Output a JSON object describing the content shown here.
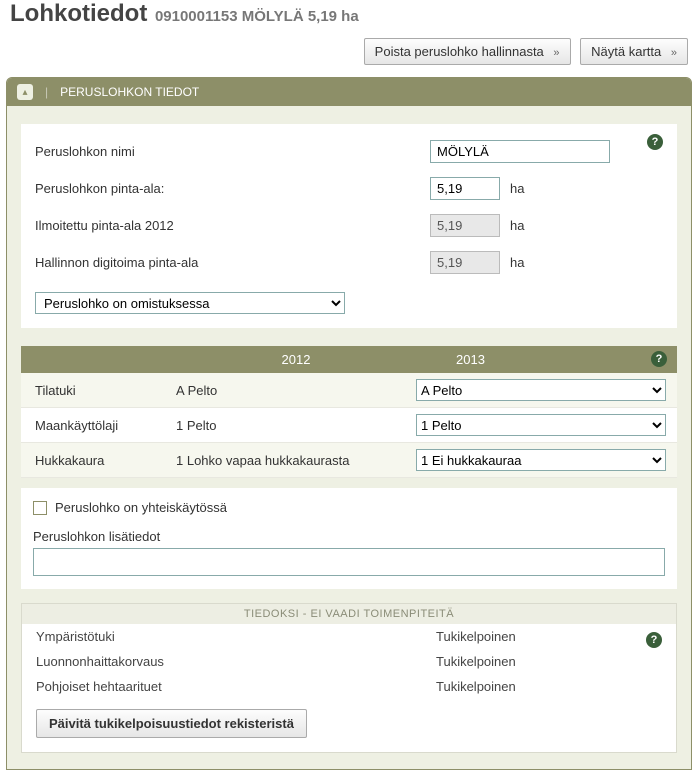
{
  "header": {
    "title": "Lohkotiedot",
    "subtitle": "0910001153 MÖLYLÄ 5,19 ha"
  },
  "topButtons": {
    "remove": "Poista peruslohko hallinnasta",
    "showMap": "Näytä kartta"
  },
  "panel": {
    "title": "PERUSLOHKON TIEDOT"
  },
  "form": {
    "nameLabel": "Peruslohkon nimi",
    "nameValue": "MÖLYLÄ",
    "areaLabel": "Peruslohkon pinta-ala:",
    "areaValue": "5,19",
    "areaUnit": "ha",
    "reportedLabel": "Ilmoitettu pinta-ala 2012",
    "reportedValue": "5,19",
    "reportedUnit": "ha",
    "digitLabel": "Hallinnon digitoima pinta-ala",
    "digitValue": "5,19",
    "digitUnit": "ha",
    "ownershipSelect": "Peruslohko on omistuksessa"
  },
  "table": {
    "head2012": "2012",
    "head2013": "2013",
    "rows": [
      {
        "label": "Tilatuki",
        "val2012": "A Pelto",
        "val2013": "A Pelto"
      },
      {
        "label": "Maankäyttölaji",
        "val2012": "1 Pelto",
        "val2013": "1 Pelto"
      },
      {
        "label": "Hukkakaura",
        "val2012": "1 Lohko vapaa hukkakaurasta",
        "val2013": "1 Ei hukkakauraa"
      }
    ]
  },
  "shared": {
    "checkboxLabel": "Peruslohko on yhteiskäytössä",
    "extraLabel": "Peruslohkon lisätiedot",
    "extraValue": ""
  },
  "info": {
    "header": "TIEDOKSI - EI VAADI TOIMENPITEITÄ",
    "rows": [
      {
        "label": "Ympäristötuki",
        "status": "Tukikelpoinen"
      },
      {
        "label": "Luonnonhaittakorvaus",
        "status": "Tukikelpoinen"
      },
      {
        "label": "Pohjoiset hehtaarituet",
        "status": "Tukikelpoinen"
      }
    ],
    "updateButton": "Päivitä tukikelpoisuustiedot rekisteristä"
  }
}
